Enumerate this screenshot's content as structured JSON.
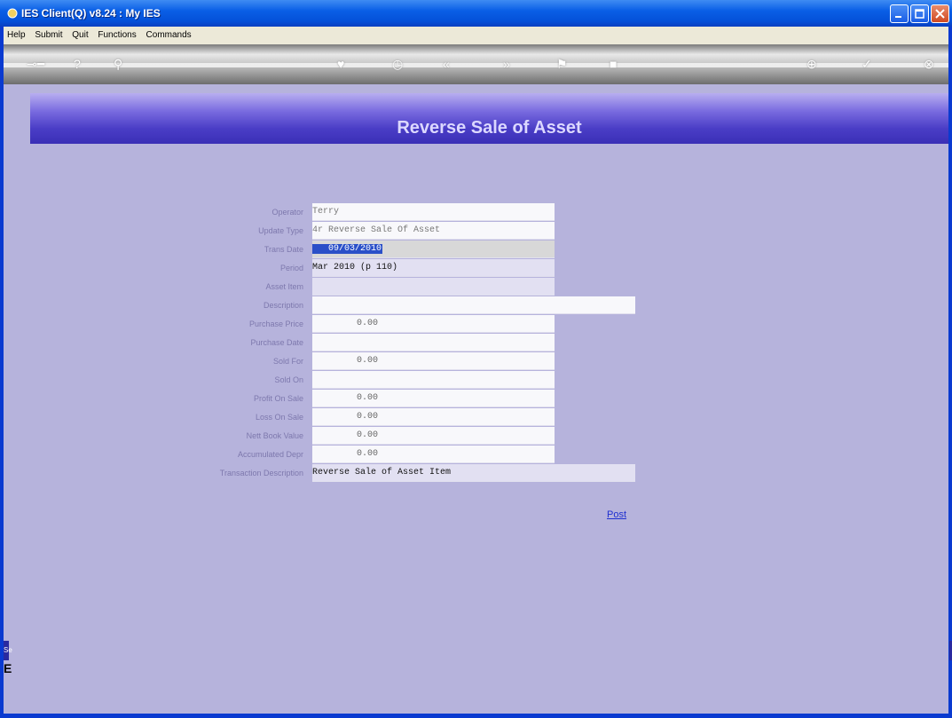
{
  "window": {
    "title": "IES Client(Q) v8.24 : My IES",
    "colors": {
      "titlebar": "#0a5fe6",
      "content_bg": "#b6b3dc",
      "banner": "#4a3dc6"
    }
  },
  "menu": [
    "Help",
    "Submit",
    "Quit",
    "Functions",
    "Commands"
  ],
  "toolbar": {
    "icons": [
      "key-icon",
      "help-icon",
      "search-icon",
      "heart-icon",
      "clock-icon",
      "back-icon",
      "forward-icon",
      "flag-icon",
      "square-icon",
      "target-icon",
      "check-icon",
      "close-icon"
    ]
  },
  "form": {
    "title": "Reverse Sale of Asset",
    "fields": [
      {
        "label": "Operator",
        "value": "Terry"
      },
      {
        "label": "Update Type",
        "value": "4r Reverse Sale Of Asset"
      },
      {
        "label": "Trans Date",
        "value": "09/03/2010"
      },
      {
        "label": "Period",
        "value": "Mar 2010 (p 110)"
      },
      {
        "label": "Asset Item",
        "value": ""
      },
      {
        "label": "Description",
        "value": ""
      },
      {
        "label": "Purchase Price",
        "value": "0.00"
      },
      {
        "label": "Purchase Date",
        "value": ""
      },
      {
        "label": "Sold For",
        "value": "0.00"
      },
      {
        "label": "Sold On",
        "value": ""
      },
      {
        "label": "Profit On Sale",
        "value": "0.00"
      },
      {
        "label": "Loss On Sale",
        "value": "0.00"
      },
      {
        "label": "Nett Book Value",
        "value": "0.00"
      },
      {
        "label": "Accumulated Depr",
        "value": "0.00"
      },
      {
        "label": "Transaction Description",
        "value": "Reverse Sale of Asset Item"
      }
    ],
    "post_label": "Post"
  },
  "side": {
    "left_fragment": "Se",
    "left_glyph": "E"
  }
}
